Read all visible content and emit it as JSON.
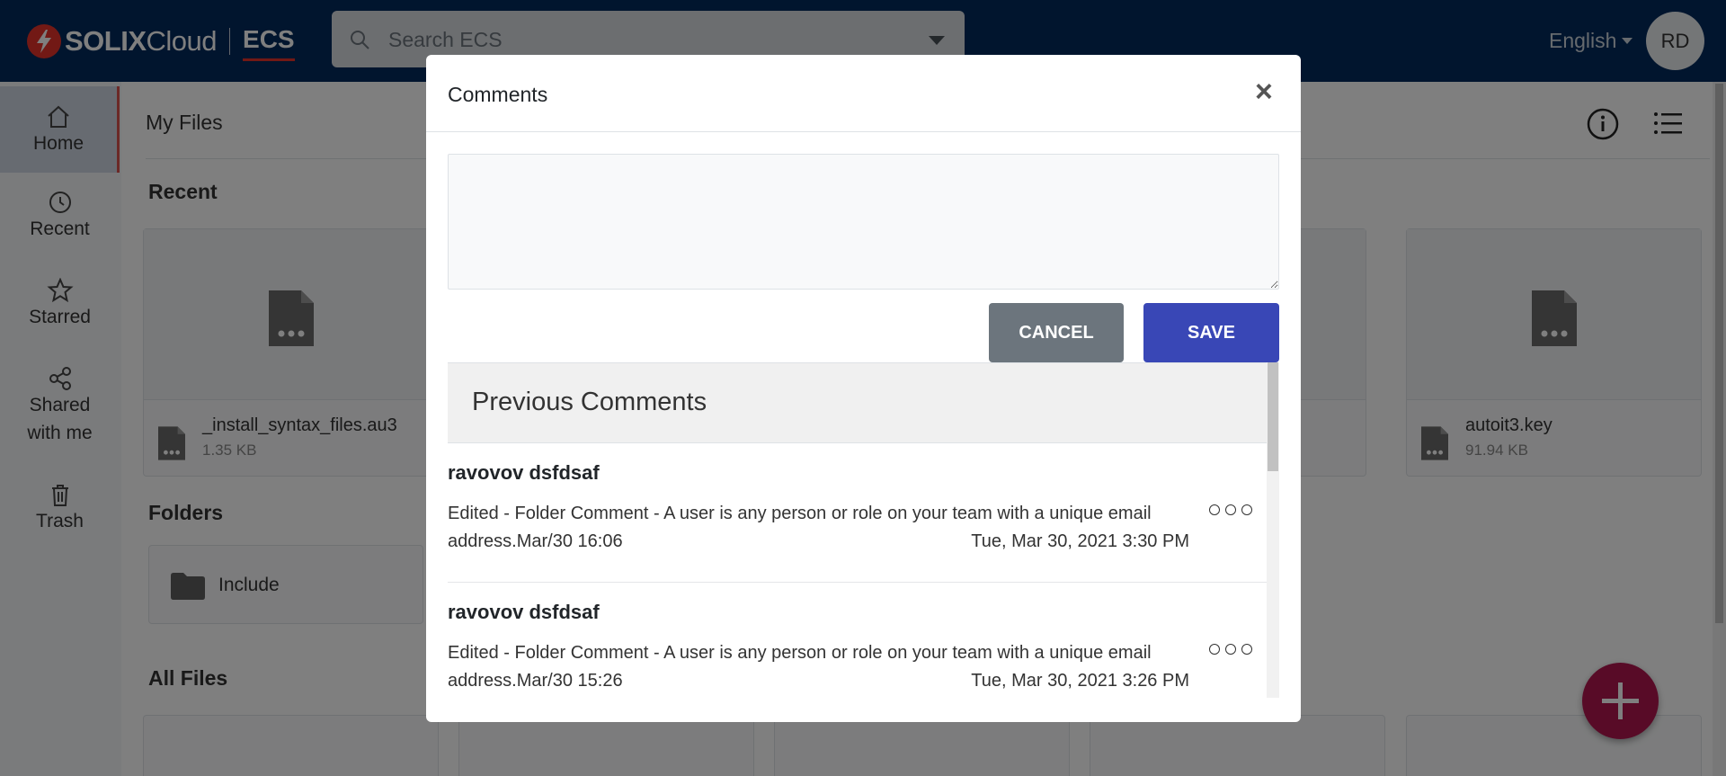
{
  "header": {
    "logo_solix": "SOLIX",
    "logo_cloud": "Cloud",
    "logo_app": "ECS",
    "search_placeholder": "Search ECS",
    "language": "English",
    "avatar_initials": "RD"
  },
  "sidebar": {
    "items": [
      {
        "label": "Home",
        "icon": "home-icon",
        "active": true
      },
      {
        "label": "Recent",
        "icon": "clock-icon"
      },
      {
        "label": "Starred",
        "icon": "star-icon"
      },
      {
        "label": "Shared with me",
        "icon": "share-icon"
      },
      {
        "label": "Trash",
        "icon": "trash-icon"
      }
    ]
  },
  "main": {
    "title": "My Files",
    "sections": {
      "recent": "Recent",
      "folders": "Folders",
      "all_files": "All Files"
    },
    "recent_files": [
      {
        "name": "_install_syntax_files.au3",
        "size": "1.35 KB"
      },
      {
        "name": "autoit3.key",
        "size": "91.94 KB"
      }
    ],
    "folders": [
      {
        "name": "Include"
      }
    ]
  },
  "modal": {
    "title": "Comments",
    "close_glyph": "×",
    "comment_value": "",
    "cancel_label": "CANCEL",
    "save_label": "SAVE",
    "previous_title": "Previous Comments",
    "comments": [
      {
        "author": "ravovov dsfdsaf",
        "text": "Edited - Folder Comment - A user is any person or role on your team with a unique email address.Mar/30 16:06",
        "date": "Tue, Mar 30, 2021 3:30 PM"
      },
      {
        "author": "ravovov dsfdsaf",
        "text": "Edited - Folder Comment - A user is any person or role on your team with a unique email address.Mar/30 15:26",
        "date": "Tue, Mar 30, 2021 3:26 PM"
      }
    ]
  },
  "colors": {
    "topbar": "#032a5c",
    "brand_red": "#e5332a",
    "save_button": "#3947b6",
    "cancel_button": "#6c757d",
    "fab": "#b0164f"
  }
}
